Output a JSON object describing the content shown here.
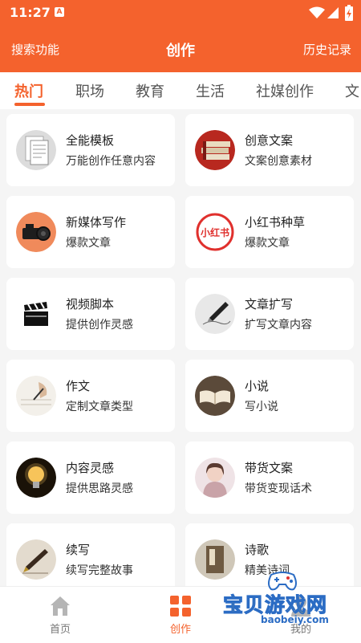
{
  "status_bar": {
    "time": "11:27",
    "notification_badge": "A"
  },
  "header": {
    "search_label": "搜索功能",
    "title": "创作",
    "history_label": "历史记录"
  },
  "tabs": [
    {
      "label": "热门",
      "active": true
    },
    {
      "label": "职场"
    },
    {
      "label": "教育"
    },
    {
      "label": "生活"
    },
    {
      "label": "社媒创作"
    },
    {
      "label": "文"
    }
  ],
  "cards": [
    {
      "title": "全能模板",
      "subtitle": "万能创作任意内容",
      "icon": "document-template-icon"
    },
    {
      "title": "创意文案",
      "subtitle": "文案创意素材",
      "icon": "book-stack-icon"
    },
    {
      "title": "新媒体写作",
      "subtitle": "爆款文章",
      "icon": "camera-icon"
    },
    {
      "title": "小红书种草",
      "subtitle": "爆款文章",
      "icon": "xiaohongshu-icon",
      "logo_text": "小红书"
    },
    {
      "title": "视频脚本",
      "subtitle": "提供创作灵感",
      "icon": "clapperboard-icon"
    },
    {
      "title": "文章扩写",
      "subtitle": "扩写文章内容",
      "icon": "pen-writing-icon"
    },
    {
      "title": "作文",
      "subtitle": "定制文章类型",
      "icon": "hand-writing-icon"
    },
    {
      "title": "小说",
      "subtitle": "写小说",
      "icon": "open-book-icon"
    },
    {
      "title": "内容灵感",
      "subtitle": "提供思路灵感",
      "icon": "lightbulb-icon"
    },
    {
      "title": "带货文案",
      "subtitle": "带货变现话术",
      "icon": "portrait-icon"
    },
    {
      "title": "续写",
      "subtitle": "续写完整故事",
      "icon": "fountain-pen-icon"
    },
    {
      "title": "诗歌",
      "subtitle": "精美诗词",
      "icon": "poetry-book-icon"
    }
  ],
  "bottom_nav": [
    {
      "label": "首页",
      "icon": "home-icon"
    },
    {
      "label": "创作",
      "icon": "grid-icon",
      "active": true
    },
    {
      "label": "我的",
      "icon": "profile-icon"
    }
  ],
  "watermark": {
    "text": "宝贝游戏网",
    "url": "baobeiy.com"
  },
  "colors": {
    "accent": "#f4622d",
    "background": "#f5f5f5",
    "card": "#ffffff"
  }
}
